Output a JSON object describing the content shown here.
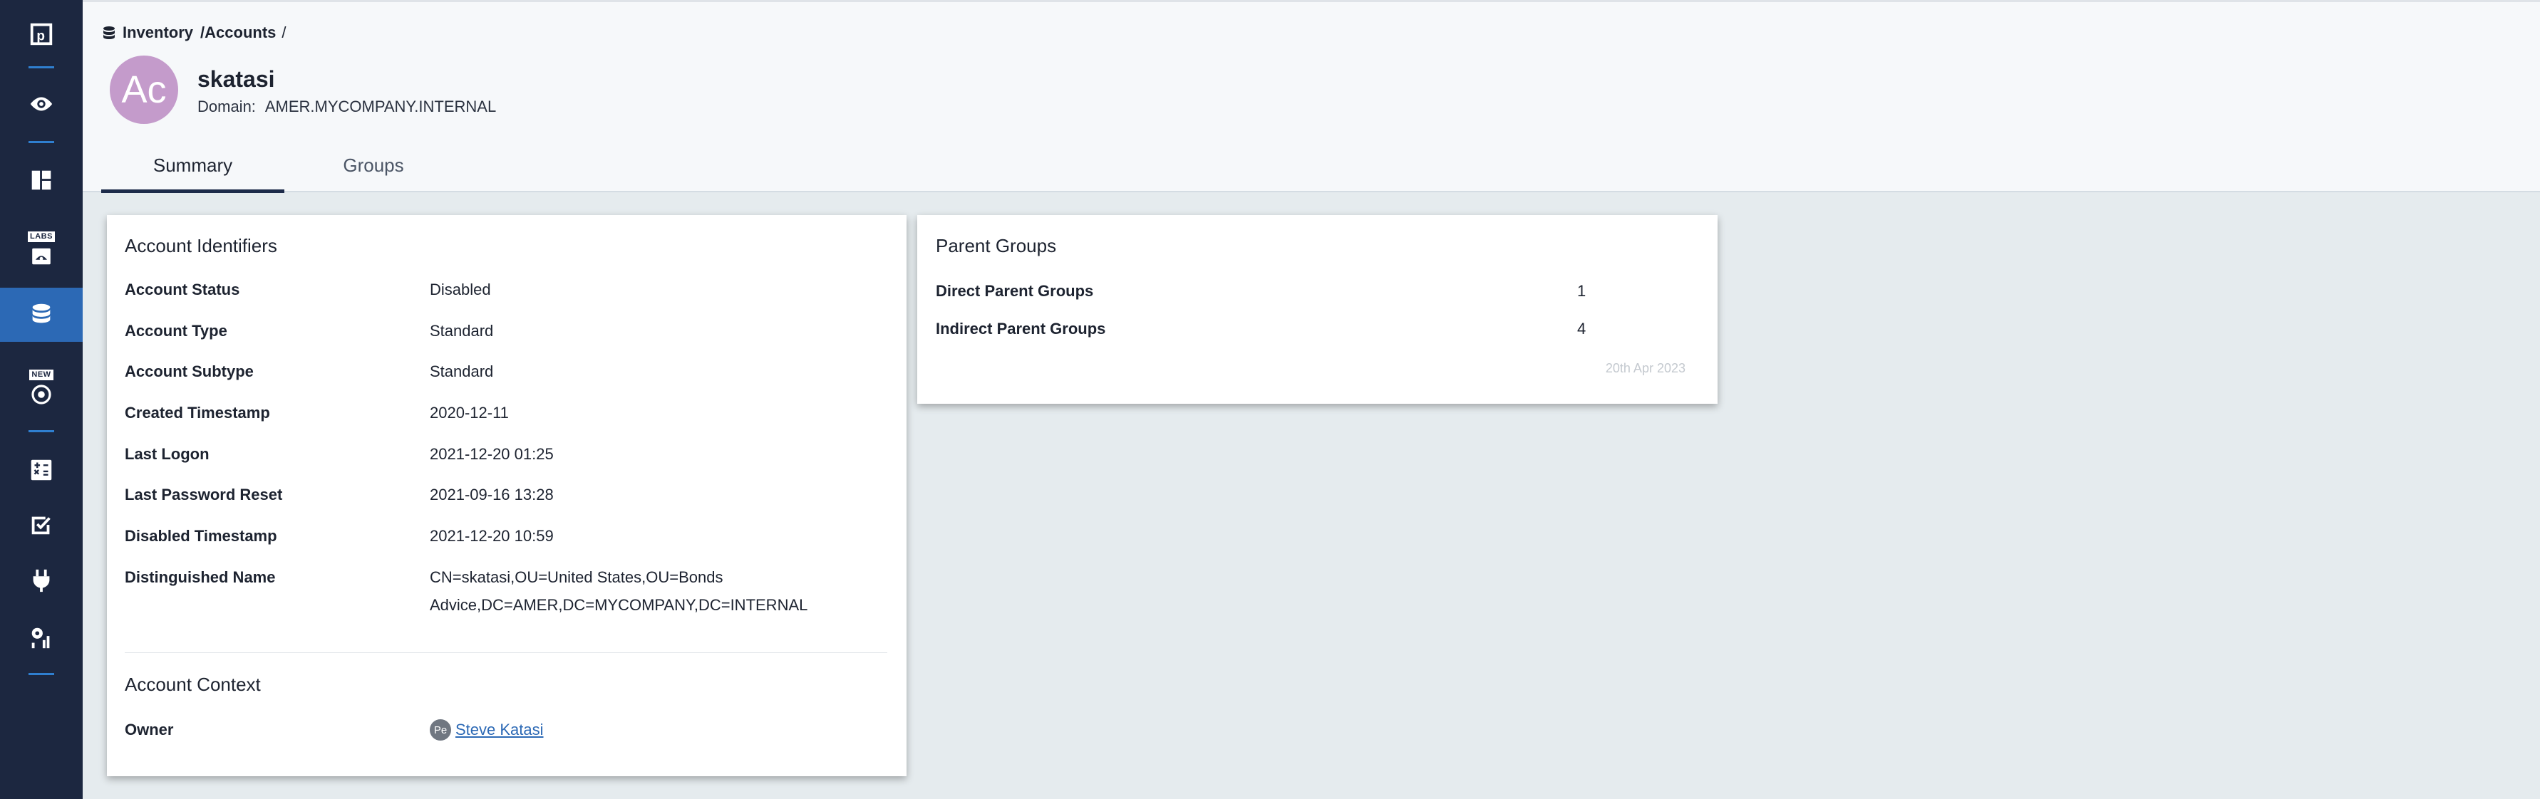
{
  "sidebar": {
    "items": [
      {
        "icon": "logo-icon",
        "active": false
      },
      {
        "icon": "eye-icon",
        "active": false
      },
      {
        "icon": "dashboard-icon",
        "active": false
      },
      {
        "icon": "labs-icon",
        "tag": "LABS",
        "active": false
      },
      {
        "icon": "database-icon",
        "active": true
      },
      {
        "icon": "target-icon",
        "tag": "NEW",
        "active": false
      },
      {
        "icon": "calculator-icon",
        "active": false
      },
      {
        "icon": "checklist-icon",
        "active": false
      },
      {
        "icon": "plug-icon",
        "active": false
      },
      {
        "icon": "settings-chart-icon",
        "active": false
      }
    ]
  },
  "header": {
    "breadcrumb": {
      "inventory": "Inventory",
      "accounts": "/Accounts",
      "trail": "/"
    },
    "avatar_initials": "Ac",
    "account_name": "skatasi",
    "domain_label": "Domain:",
    "domain_value": "AMER.MYCOMPANY.INTERNAL",
    "tabs": [
      {
        "label": "Summary",
        "active": true
      },
      {
        "label": "Groups",
        "active": false
      }
    ]
  },
  "identifiers": {
    "title": "Account Identifiers",
    "rows": [
      {
        "label": "Account Status",
        "value": "Disabled"
      },
      {
        "label": "Account Type",
        "value": "Standard"
      },
      {
        "label": "Account Subtype",
        "value": "Standard"
      },
      {
        "label": "Created Timestamp",
        "value": "2020-12-11"
      },
      {
        "label": "Last Logon",
        "value": "2021-12-20 01:25"
      },
      {
        "label": "Last Password Reset",
        "value": "2021-09-16 13:28"
      },
      {
        "label": "Disabled Timestamp",
        "value": "2021-12-20 10:59"
      },
      {
        "label": "Distinguished Name",
        "value": "CN=skatasi,OU=United States,OU=Bonds Advice,DC=AMER,DC=MYCOMPANY,DC=INTERNAL"
      }
    ]
  },
  "context": {
    "title": "Account Context",
    "owner_label": "Owner",
    "owner_initials": "Pe",
    "owner_name": "Steve Katasi"
  },
  "parent_groups": {
    "title": "Parent Groups",
    "rows": [
      {
        "label": "Direct Parent Groups",
        "value": "1"
      },
      {
        "label": "Indirect Parent Groups",
        "value": "4"
      }
    ],
    "date": "20th Apr 2023"
  },
  "colors": {
    "sidebar_bg": "#1c2740",
    "sidebar_active": "#2c69b5",
    "avatar": "#c49bcb",
    "link": "#2c69b5",
    "content_bg": "#e5ebee"
  }
}
